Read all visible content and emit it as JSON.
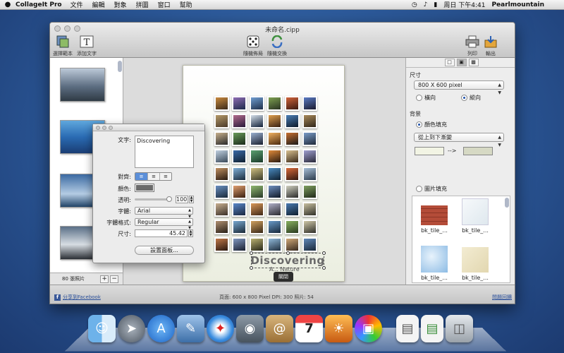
{
  "menubar": {
    "apple": "",
    "app_name": "CollageIt Pro",
    "menus": [
      "文件",
      "編輯",
      "對象",
      "拼圖",
      "窗口",
      "幫助"
    ],
    "clock": "周日 下午4:41",
    "user": "Pearlmountain"
  },
  "window": {
    "title": "未命名.cipp",
    "toolbar": {
      "choose_template": "選擇範本",
      "add_text": "添加文字",
      "random_layout": "隨機佈局",
      "random_swap": "隨機交換",
      "print": "列印",
      "export": "輸出"
    }
  },
  "photo_panel": {
    "count_label": "80 張照片",
    "add": "+",
    "remove": "−"
  },
  "canvas": {
    "caption": "Discovering",
    "subcaption": "A... Nature",
    "hud_label": "關閉"
  },
  "text_panel": {
    "text_label": "文字:",
    "text_value": "Discovering",
    "align_label": "對齊:",
    "align_options": [
      "≡",
      "≡",
      "≡"
    ],
    "color_label": "顏色:",
    "opacity_label": "透明:",
    "opacity_value": "100",
    "font_label": "字體:",
    "font_value": "Arial",
    "style_label": "字體格式:",
    "style_value": "Regular",
    "size_label": "尺寸:",
    "size_value": "45.42",
    "settings_button": "設置面板..."
  },
  "right_panel": {
    "size_heading": "尺寸",
    "size_value": "800 X 600 pixel",
    "orientation": {
      "landscape": "橫向",
      "portrait": "縱向",
      "selected": "portrait"
    },
    "bg_heading": "背景",
    "color_fill": "顏色填充",
    "gradient_value": "從上到下漸變",
    "gradient_arrow": "-->",
    "image_fill": "圖片填充",
    "tiles": [
      "bk_tile_...",
      "bk_tile_...",
      "bk_tile_...",
      "bk_tile_..."
    ],
    "colors": {
      "from": "#f2f4e4",
      "to": "#d6d9c4"
    }
  },
  "statusbar": {
    "facebook": "分享到Facebook",
    "fb_icon": "f",
    "info": "頁面: 600 x 800 Pixel  DPI: 300  照片: 54",
    "feedback": "問題回饋"
  },
  "dock": {
    "icons": [
      "finder-icon",
      "launchpad-icon",
      "app-store-icon",
      "preview-icon",
      "safari-icon",
      "facetime-icon",
      "address-book-icon",
      "calendar-icon",
      "iphoto-icon",
      "collageit-icon",
      "document-icon",
      "document-icon",
      "trash-icon"
    ],
    "calendar_day": "7"
  }
}
